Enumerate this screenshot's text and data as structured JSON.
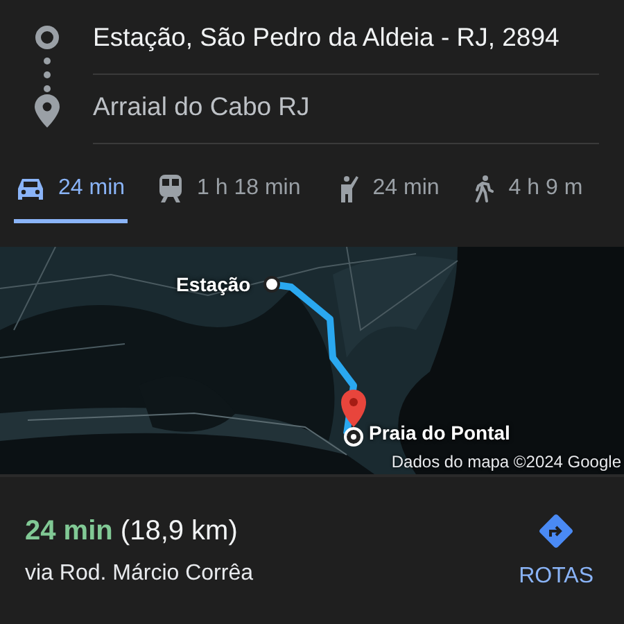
{
  "route_fields": [
    {
      "kind": "origin",
      "value": "Estação, São Pedro da Aldeia - RJ, 2894"
    },
    {
      "kind": "destination",
      "value": "Arraial do Cabo RJ"
    }
  ],
  "travel_modes": [
    {
      "kind": "car",
      "label": "24 min",
      "selected": true
    },
    {
      "kind": "transit",
      "label": "1 h 18 min",
      "selected": false
    },
    {
      "kind": "ride",
      "label": "24 min",
      "selected": false
    },
    {
      "kind": "walk",
      "label": "4 h 9 m",
      "selected": false
    }
  ],
  "map": {
    "kind": "picture",
    "start_label": "Estação",
    "end_label": "Praia do Pontal",
    "attribution": "Dados do mapa ©2024 Google"
  },
  "summary": {
    "headline": "**24 min** (18,9 km)",
    "via": "via Rod. Márcio Corrêa",
    "action": "ROTAS"
  }
}
